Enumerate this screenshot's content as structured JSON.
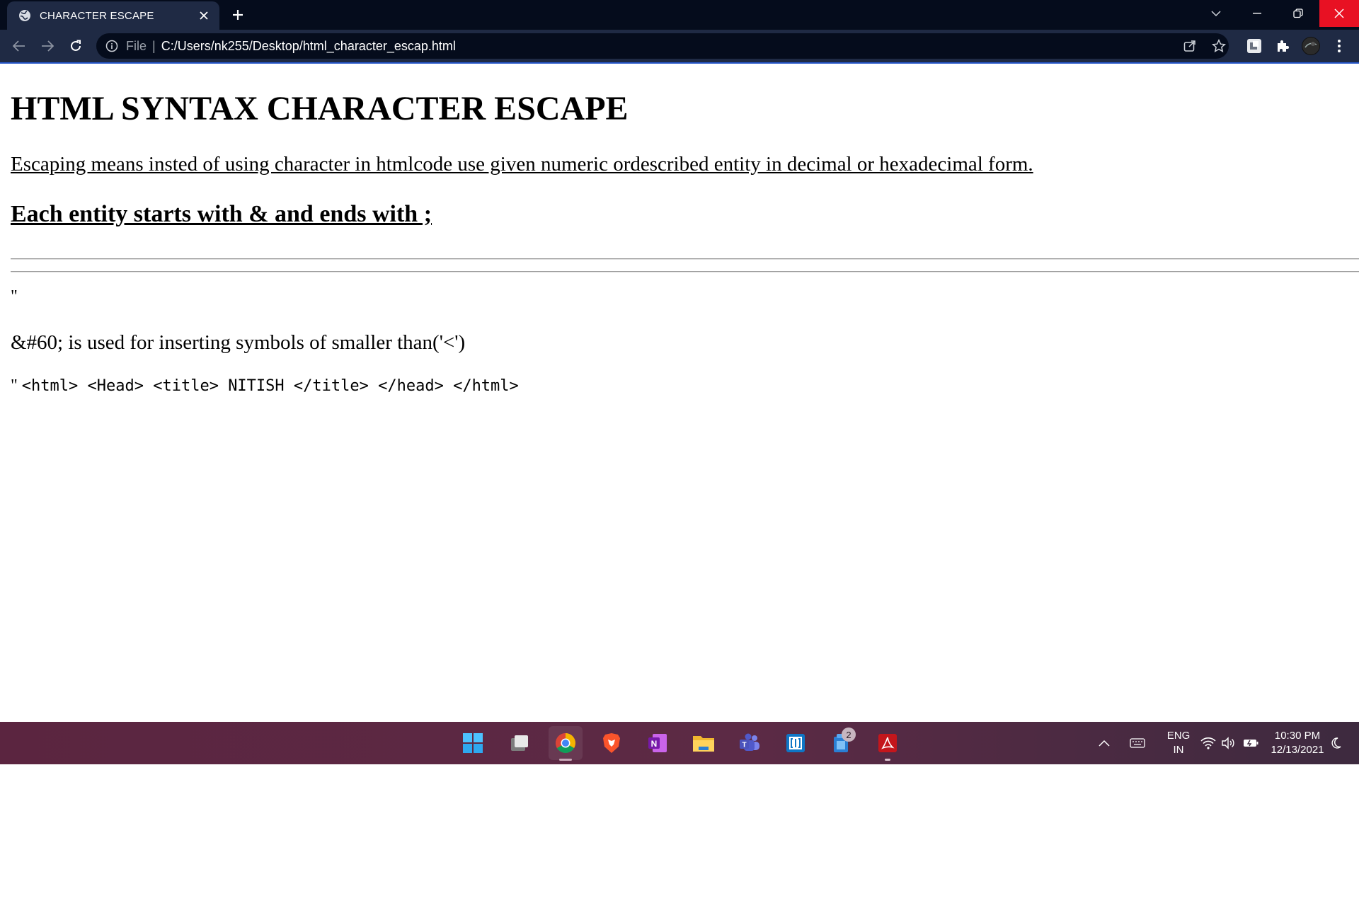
{
  "browser": {
    "tab_title": "CHARACTER ESCAPE",
    "address_scheme": "File",
    "address_url": "C:/Users/nk255/Desktop/html_character_escap.html"
  },
  "page": {
    "heading": "HTML SYNTAX CHARACTER ESCAPE",
    "lead": "Escaping means insted of using character in htmlcode use given numeric ordescribed entity in decimal or hexadecimal form.",
    "subheading": "Each entity starts with & and ends with ;",
    "quote_mark": "\"",
    "entity_paragraph": "&#60; is used for inserting symbols of smaller than('<')",
    "code_quote": "\"",
    "code_text": "<html> <Head> <title> NITISH </title> </head> </html>"
  },
  "taskbar": {
    "apps": [
      "start-icon",
      "task-view-icon",
      "chrome-icon",
      "brave-icon",
      "onenote-icon",
      "file-explorer-icon",
      "teams-icon",
      "remote-desktop-icon",
      "store-icon",
      "acrobat-icon"
    ],
    "badge_count": "2",
    "language_top": "ENG",
    "language_bottom": "IN",
    "time": "10:30 PM",
    "date": "12/13/2021"
  },
  "colors": {
    "titlebar": "#050c1c",
    "toolbar": "#1f2a44",
    "close_button": "#e81123",
    "taskbar": "#5b2540"
  }
}
